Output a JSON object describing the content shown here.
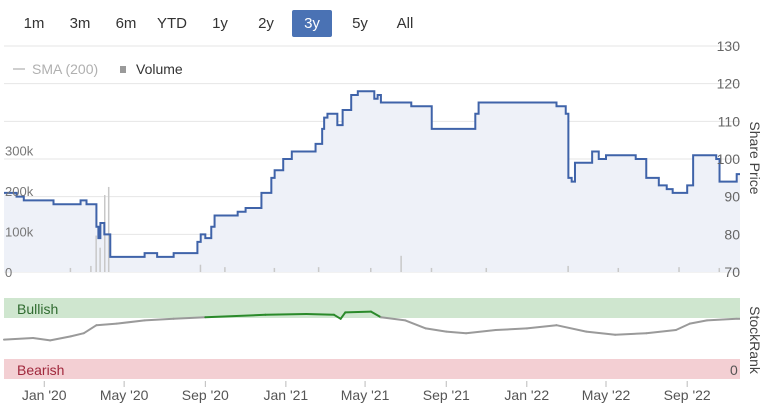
{
  "range_selector": {
    "buttons": [
      "1m",
      "3m",
      "6m",
      "YTD",
      "1y",
      "2y",
      "3y",
      "5y",
      "All"
    ],
    "active": "3y"
  },
  "legend": {
    "sma_label": "SMA (200)",
    "volume_label": "Volume"
  },
  "colors": {
    "price_line": "#3f63a9",
    "price_fill": "#eef1f8",
    "volume_bar": "#c8c8c8",
    "stockrank_line": "#9a9a9a",
    "stockrank_bullish_line": "#2a8a2a",
    "bullish_band": "#cfe6cf",
    "bearish_band": "#f3cfd3",
    "active_button": "#4a72b4"
  },
  "chart_data": [
    {
      "type": "line",
      "name": "price-chart",
      "ylabel": "Share Price",
      "ylim": [
        70,
        130
      ],
      "y_ticks": [
        "130",
        "120",
        "110",
        "100",
        "90",
        "80",
        "70"
      ],
      "y_tick_values": [
        130,
        120,
        110,
        100,
        90,
        80,
        70
      ],
      "x_ticks": [
        "Jan '20",
        "May '20",
        "Sep '20",
        "Jan '21",
        "May '21",
        "Sep '21",
        "Jan '22",
        "May '22",
        "Sep '22"
      ],
      "x_tick_dates": [
        "2020-01-01",
        "2020-05-01",
        "2020-09-01",
        "2021-01-01",
        "2021-05-01",
        "2021-09-01",
        "2022-01-01",
        "2022-05-01",
        "2022-09-01"
      ],
      "x_range": [
        "2019-11-01",
        "2022-11-20"
      ],
      "grid": true,
      "series": [
        {
          "values": [
            [
              "2019-11-01",
              91
            ],
            [
              "2019-11-20",
              90
            ],
            [
              "2019-12-01",
              89
            ],
            [
              "2020-01-15",
              88
            ],
            [
              "2020-02-15",
              88
            ],
            [
              "2020-02-25",
              89
            ],
            [
              "2020-03-05",
              88
            ],
            [
              "2020-03-20",
              82
            ],
            [
              "2020-03-23",
              79
            ],
            [
              "2020-03-26",
              83
            ],
            [
              "2020-04-01",
              80
            ],
            [
              "2020-04-10",
              74
            ],
            [
              "2020-05-10",
              74
            ],
            [
              "2020-06-01",
              75
            ],
            [
              "2020-06-20",
              74
            ],
            [
              "2020-07-15",
              75
            ],
            [
              "2020-08-20",
              78
            ],
            [
              "2020-08-25",
              80
            ],
            [
              "2020-09-01",
              79
            ],
            [
              "2020-09-10",
              82
            ],
            [
              "2020-09-15",
              85
            ],
            [
              "2020-10-20",
              86
            ],
            [
              "2020-11-01",
              87
            ],
            [
              "2020-11-25",
              91
            ],
            [
              "2020-12-10",
              95
            ],
            [
              "2020-12-15",
              97
            ],
            [
              "2020-12-28",
              100
            ],
            [
              "2021-01-10",
              102
            ],
            [
              "2021-02-15",
              104
            ],
            [
              "2021-02-25",
              108
            ],
            [
              "2021-02-28",
              111
            ],
            [
              "2021-03-05",
              112
            ],
            [
              "2021-03-20",
              109
            ],
            [
              "2021-03-28",
              113
            ],
            [
              "2021-04-10",
              117
            ],
            [
              "2021-04-20",
              118
            ],
            [
              "2021-05-15",
              116
            ],
            [
              "2021-05-20",
              117
            ],
            [
              "2021-05-25",
              115
            ],
            [
              "2021-07-10",
              114
            ],
            [
              "2021-08-10",
              108
            ],
            [
              "2021-10-15",
              112
            ],
            [
              "2021-10-20",
              115
            ],
            [
              "2022-02-15",
              114
            ],
            [
              "2022-03-01",
              112
            ],
            [
              "2022-03-05",
              95
            ],
            [
              "2022-03-10",
              94
            ],
            [
              "2022-03-15",
              99
            ],
            [
              "2022-04-10",
              102
            ],
            [
              "2022-04-20",
              100
            ],
            [
              "2022-05-01",
              101
            ],
            [
              "2022-06-15",
              100
            ],
            [
              "2022-07-01",
              95
            ],
            [
              "2022-07-20",
              93
            ],
            [
              "2022-08-01",
              92
            ],
            [
              "2022-08-10",
              91
            ],
            [
              "2022-09-01",
              93
            ],
            [
              "2022-09-10",
              101
            ],
            [
              "2022-10-15",
              100
            ],
            [
              "2022-10-20",
              94
            ],
            [
              "2022-11-10",
              94
            ],
            [
              "2022-11-15",
              96
            ]
          ]
        }
      ]
    },
    {
      "type": "bar",
      "name": "volume-chart",
      "y_ticks": [
        "300k",
        "200k",
        "100k",
        "0"
      ],
      "y_tick_values": [
        300000,
        200000,
        100000,
        0
      ],
      "ylim": [
        0,
        400000
      ],
      "series": [
        {
          "name": "Volume",
          "values": [
            [
              "2020-03-12",
              15000
            ],
            [
              "2020-03-20",
              90000
            ],
            [
              "2020-03-26",
              60000
            ],
            [
              "2020-04-02",
              190000
            ],
            [
              "2020-04-08",
              210000
            ],
            [
              "2020-02-10",
              10000
            ],
            [
              "2020-08-25",
              18000
            ],
            [
              "2020-10-01",
              12000
            ],
            [
              "2020-12-15",
              10000
            ],
            [
              "2021-02-20",
              12000
            ],
            [
              "2021-05-10",
              10000
            ],
            [
              "2021-06-25",
              40000
            ],
            [
              "2021-08-10",
              10000
            ],
            [
              "2021-11-01",
              10000
            ],
            [
              "2022-03-05",
              15000
            ],
            [
              "2022-05-20",
              10000
            ],
            [
              "2022-08-20",
              12000
            ],
            [
              "2022-10-20",
              10000
            ]
          ]
        }
      ]
    },
    {
      "type": "line",
      "name": "stockrank-chart",
      "ylabel": "StockRank",
      "zones": [
        "Bullish",
        "Bearish"
      ],
      "y_ticks": [
        "0"
      ],
      "ylim": [
        0,
        100
      ],
      "series": [
        {
          "values": [
            [
              "2019-11-01",
              48
            ],
            [
              "2019-12-15",
              50
            ],
            [
              "2020-01-10",
              47
            ],
            [
              "2020-02-10",
              52
            ],
            [
              "2020-03-01",
              56
            ],
            [
              "2020-03-20",
              66
            ],
            [
              "2020-04-20",
              68
            ],
            [
              "2020-06-01",
              72
            ],
            [
              "2020-07-15",
              74
            ],
            [
              "2020-09-01",
              76
            ],
            [
              "2020-12-01",
              79
            ],
            [
              "2021-02-01",
              80
            ],
            [
              "2021-03-15",
              79
            ],
            [
              "2021-03-25",
              74
            ],
            [
              "2021-04-01",
              82
            ],
            [
              "2021-05-10",
              83
            ],
            [
              "2021-05-25",
              76
            ],
            [
              "2021-07-01",
              72
            ],
            [
              "2021-08-01",
              62
            ],
            [
              "2021-09-01",
              58
            ],
            [
              "2021-10-01",
              56
            ],
            [
              "2021-11-15",
              60
            ],
            [
              "2022-01-01",
              62
            ],
            [
              "2022-02-15",
              66
            ],
            [
              "2022-04-01",
              58
            ],
            [
              "2022-05-15",
              54
            ],
            [
              "2022-07-01",
              56
            ],
            [
              "2022-08-15",
              60
            ],
            [
              "2022-09-05",
              68
            ],
            [
              "2022-10-01",
              72
            ],
            [
              "2022-11-15",
              74
            ]
          ],
          "bullish_segment": [
            "2020-09-01",
            "2021-05-25"
          ]
        }
      ]
    }
  ]
}
